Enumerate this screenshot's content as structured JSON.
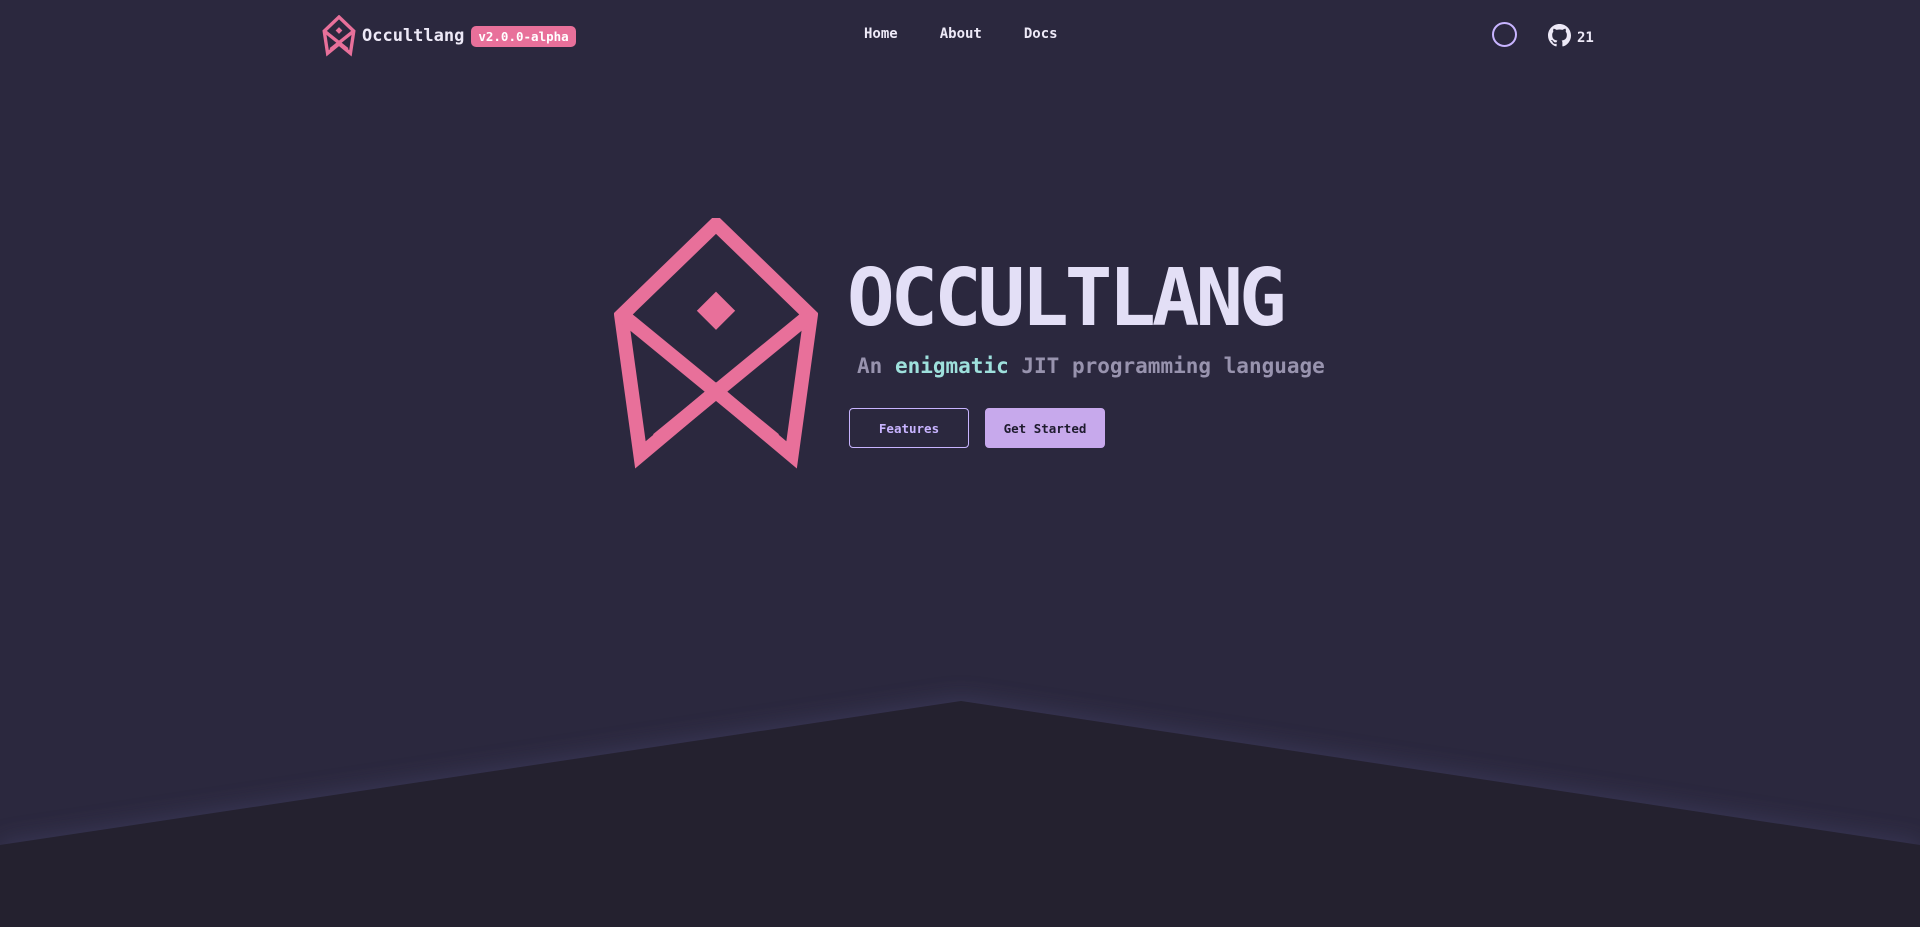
{
  "brand": {
    "name": "Occultlang",
    "version": "v2.0.0-alpha",
    "logo_icon": "occultlang-logo-icon"
  },
  "nav": {
    "links": [
      "Home",
      "About",
      "Docs"
    ]
  },
  "github": {
    "icon": "github-icon",
    "stars": "21"
  },
  "hero": {
    "title": "OCCULTLANG",
    "tagline_prefix": "An ",
    "tagline_accent": "enigmatic",
    "tagline_suffix": " JIT programming language"
  },
  "buttons": {
    "features": "Features",
    "get_started": "Get Started"
  },
  "colors": {
    "background": "#2b283e",
    "accent_pink": "#e8709a",
    "accent_purple": "#c8b4ff",
    "accent_teal": "#9ee0dc",
    "title": "#e3dff6"
  }
}
